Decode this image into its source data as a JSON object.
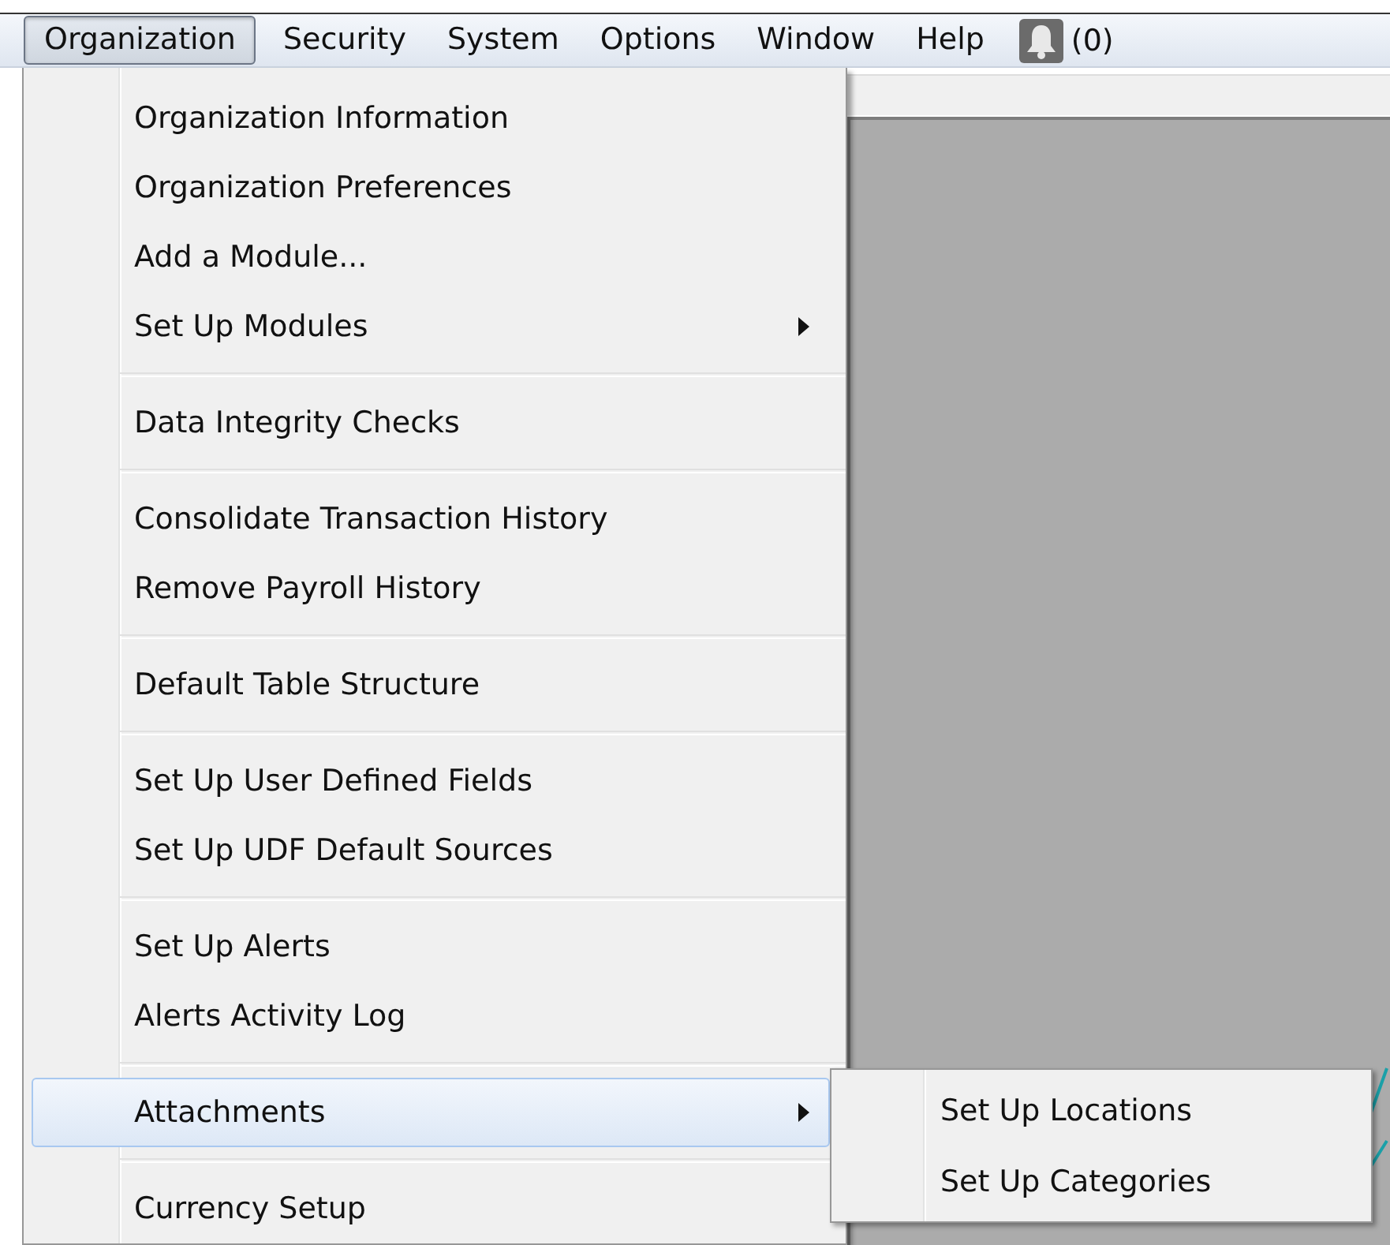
{
  "menubar": {
    "items": [
      {
        "label": "Organization",
        "selected": true
      },
      {
        "label": "Security",
        "selected": false
      },
      {
        "label": "System",
        "selected": false
      },
      {
        "label": "Options",
        "selected": false
      },
      {
        "label": "Window",
        "selected": false
      },
      {
        "label": "Help",
        "selected": false
      }
    ],
    "notifications": {
      "count": "(0)"
    }
  },
  "menu": {
    "groups": [
      [
        {
          "label": "Organization Information",
          "has_submenu": false,
          "selected": false
        },
        {
          "label": "Organization Preferences",
          "has_submenu": false,
          "selected": false
        },
        {
          "label": "Add a Module...",
          "has_submenu": false,
          "selected": false
        },
        {
          "label": "Set Up Modules",
          "has_submenu": true,
          "selected": false
        }
      ],
      [
        {
          "label": "Data Integrity Checks",
          "has_submenu": false,
          "selected": false
        }
      ],
      [
        {
          "label": "Consolidate Transaction History",
          "has_submenu": false,
          "selected": false
        },
        {
          "label": "Remove Payroll History",
          "has_submenu": false,
          "selected": false
        }
      ],
      [
        {
          "label": "Default Table Structure",
          "has_submenu": false,
          "selected": false
        }
      ],
      [
        {
          "label": "Set Up User Defined Fields",
          "has_submenu": false,
          "selected": false
        },
        {
          "label": "Set Up UDF Default Sources",
          "has_submenu": false,
          "selected": false
        }
      ],
      [
        {
          "label": "Set Up Alerts",
          "has_submenu": false,
          "selected": false
        },
        {
          "label": "Alerts Activity Log",
          "has_submenu": false,
          "selected": false
        }
      ],
      [
        {
          "label": "Attachments",
          "has_submenu": true,
          "selected": true,
          "children": [
            {
              "label": "Set Up Locations"
            },
            {
              "label": "Set Up Categories"
            }
          ]
        }
      ],
      [
        {
          "label": "Currency Setup",
          "has_submenu": false,
          "selected": false
        }
      ]
    ]
  }
}
